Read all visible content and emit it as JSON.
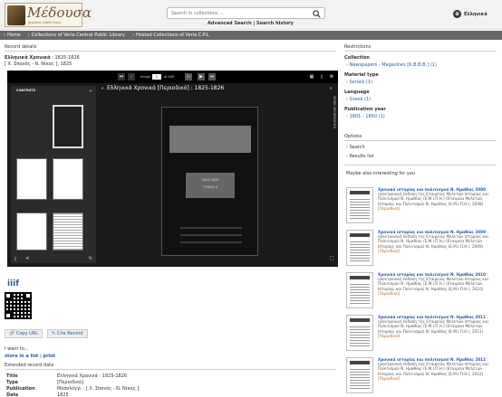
{
  "header": {
    "logo_text": "Μέδουσα",
    "logo_sub": "ψηφιακό αποθετήριο",
    "search_placeholder": "Search in collections ...",
    "advanced_search": "Advanced Search",
    "separator": "|",
    "search_history": "Search history",
    "language": "Ελληνικά"
  },
  "breadcrumb": [
    "Home",
    "Collections of Veria Central Public Library",
    "Hosted Collections of Veria C.P.L."
  ],
  "record": {
    "section_label": "Record details",
    "title_bold": "Ελληνικά Χρονικά",
    "title_rest": " : 1825-1826",
    "subtitle": "[ Χ. Σπανός - Ν. Νίκας ], 1825"
  },
  "viewer": {
    "contents_label": "CONTENTS",
    "title": "Ελληνικά Χρονικά [Περιοδικό] : 1825-1826",
    "image_label": "Image",
    "page_value": "1",
    "of_label": "of 400",
    "side_tab": "MORE INFORMATION",
    "page_text_1": "1825-1826",
    "page_text_2": "ΤΟΜΟΣ Α"
  },
  "below_viewer": {
    "iiif": "iiif",
    "copy_url": "Copy URL",
    "cite_record": "Cite Record",
    "i_want": "I want to...",
    "store_in_list": "store in a list",
    "print": "print",
    "extended_label": "Extended record data"
  },
  "metadata": [
    {
      "key": "Title",
      "value": "Ελληνικά Χρονικά : 1825-1826"
    },
    {
      "key": "Type",
      "value": "[Περιοδικό]"
    },
    {
      "key": "Publication",
      "value": "Μεσολόγγι : [ Χ. Σπανός - Ν. Νίκας ]"
    },
    {
      "key": "Date",
      "value": "1825"
    }
  ],
  "restrictions": {
    "label": "Restrictions",
    "collection_heading": "Collection",
    "collection_item": "Newspapers - Magazines [Κ.Β.Β.Β.] (1)",
    "material_heading": "Material type",
    "material_item": "Serials (1)",
    "language_heading": "Language",
    "language_item": "Greek (1)",
    "pubyear_heading": "Publication year",
    "pubyear_item": "1801 - 1850 (1)"
  },
  "options": {
    "label": "Options",
    "search": "Search",
    "results_list": "Results list"
  },
  "related": {
    "label": "Maybe also interesting for you",
    "items": [
      {
        "title": "Χρονικά ιστορίας και πολιτισμού Ν. Ημαθίας 2008",
        "desc": ": ηλεκτρονική έκδοση της Εταιρείας Μελετών Ιστορίας και Πολιτισμού Ν. Ημαθίας (Ε.Μ.Ι.Π.Η.) (Εταιρεία Μελετών Ιστορίας και Πολιτισμού Ν. Ημαθίας (Ε.Μ.Ι.Π.Η.), 2008)",
        "tag": "[Περιοδικό]"
      },
      {
        "title": "Χρονικά ιστορίας και πολιτισμού Ν. Ημαθίας 2009",
        "desc": ": ηλεκτρονική έκδοση της Εταιρείας Μελετών Ιστορίας και Πολιτισμού Ν. Ημαθίας (Ε.Μ.Ι.Π.Η.) (Εταιρεία Μελετών Ιστορίας και Πολιτισμού Ν. Ημαθίας (Ε.Μ.Ι.Π.Η.), 2009)",
        "tag": "[Περιοδικό]"
      },
      {
        "title": "Χρονικά ιστορίας και πολιτισμού Ν. Ημαθίας 2010",
        "desc": ": ηλεκτρονική έκδοση της Εταιρείας Μελετών Ιστορίας και Πολιτισμού Ν. Ημαθίας (Ε.Μ.Ι.Π.Η.) (Εταιρεία Μελετών Ιστορίας και Πολιτισμού Ν. Ημαθίας (Ε.Μ.Ι.Π.Η.), 2010)",
        "tag": "[Περιοδικό]"
      },
      {
        "title": "Χρονικά ιστορίας και πολιτισμού Ν. Ημαθίας 2011",
        "desc": ": ηλεκτρονική έκδοση της Εταιρείας Μελετών Ιστορίας και Πολιτισμού Ν. Ημαθίας (Ε.Μ.Ι.Π.Η.) (Εταιρεία Μελετών Ιστορίας και Πολιτισμού Ν. Ημαθίας (Ε.Μ.Ι.Π.Η.), 2011)",
        "tag": "[Περιοδικό]"
      },
      {
        "title": "Χρονικά ιστορίας και πολιτισμού Ν. Ημαθίας 2012",
        "desc": ": ηλεκτρονική έκδοση της Εταιρείας Μελετών Ιστορίας και Πολιτισμού Ν. Ημαθίας (Ε.Μ.Ι.Π.Η.) (Εταιρεία Μελετών Ιστορίας και Πολιτισμού Ν. Ημαθίας (Ε.Μ.Ι.Π.Η.), 2012)",
        "tag": "[Περιοδικό]"
      }
    ]
  }
}
